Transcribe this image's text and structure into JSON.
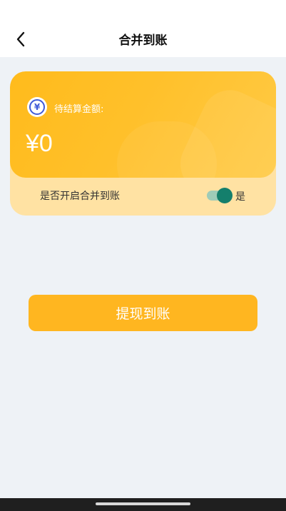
{
  "header": {
    "title": "合并到账",
    "back_icon": "chevron-left-icon"
  },
  "card": {
    "coin_icon": "yuan-coin-icon",
    "coin_symbol": "¥",
    "pending_label": "待结算金额:",
    "amount": "¥0",
    "merge_label": "是否开启合并到账",
    "toggle_on": true,
    "toggle_state_label": "是"
  },
  "actions": {
    "withdraw_label": "提现到账"
  },
  "colors": {
    "accent": "#ffb620",
    "toggle_on": "#147f6c",
    "background": "#eef2f6"
  }
}
